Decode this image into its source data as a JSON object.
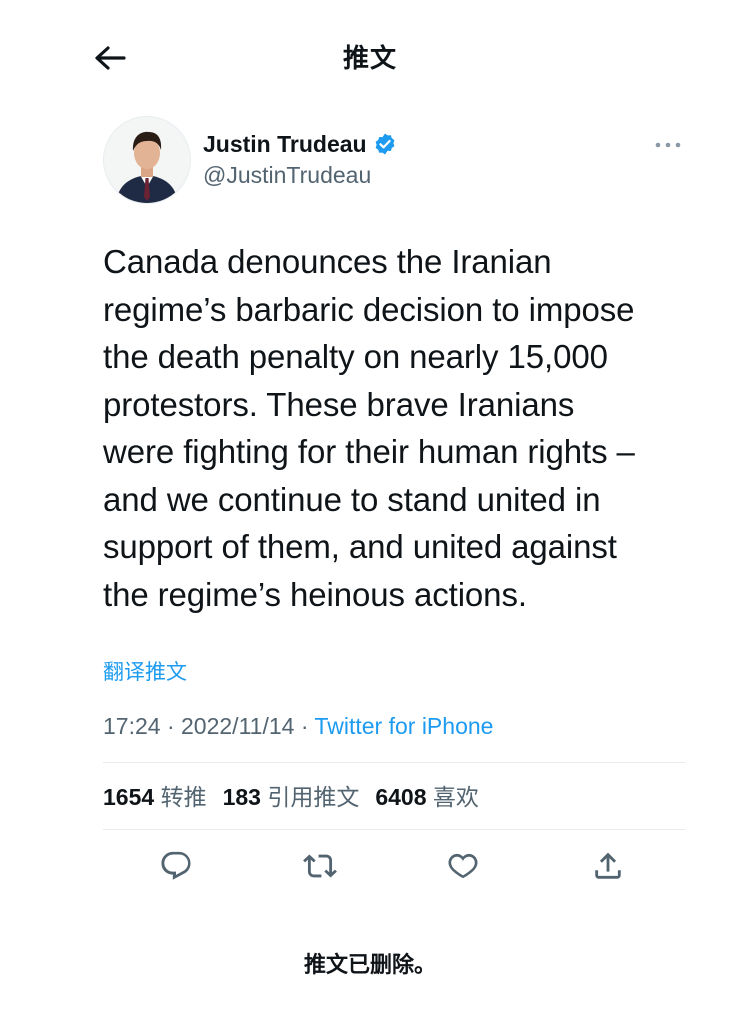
{
  "header": {
    "title": "推文"
  },
  "author": {
    "name": "Justin Trudeau",
    "handle": "@JustinTrudeau",
    "verified": true
  },
  "tweet": {
    "text": "Canada denounces the Iranian\nregime’s barbaric decision to impose\nthe death penalty on nearly 15,000\nprotestors. These brave Iranians\nwere fighting for their human rights –\nand we continue to stand united in\nsupport of them, and united against\nthe regime’s heinous actions.",
    "translate_label": "翻译推文",
    "time": "17:24",
    "date": "2022/11/14",
    "separator": "·",
    "source": "Twitter for iPhone"
  },
  "stats": {
    "retweets": {
      "count": "1654",
      "label": "转推"
    },
    "quotes": {
      "count": "183",
      "label": "引用推文"
    },
    "likes": {
      "count": "6408",
      "label": "喜欢"
    }
  },
  "icons": {
    "back": "arrow-left-icon",
    "verified": "verified-badge-icon",
    "more": "more-dots-icon",
    "reply": "reply-icon",
    "retweet": "retweet-icon",
    "like": "heart-icon",
    "share": "share-icon"
  },
  "colors": {
    "accent": "#1d9bf0",
    "text": "#0f1419",
    "secondary": "#536471",
    "divider": "#e6ecf0"
  },
  "footer": {
    "deleted_notice": "推文已删除。"
  }
}
